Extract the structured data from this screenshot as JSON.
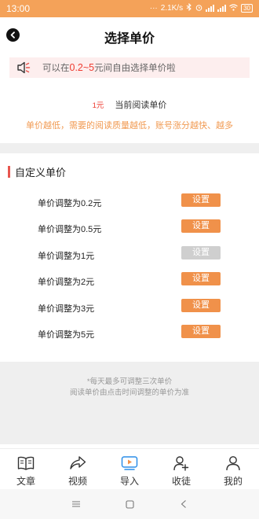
{
  "status_bar": {
    "time": "13:00",
    "dots": "···",
    "network_speed": "2.1K/s",
    "battery": "30"
  },
  "header": {
    "title": "选择单价",
    "back_icon": "chevron-left-circle-icon"
  },
  "notice": {
    "icon": "speaker-icon",
    "prefix": "可以在",
    "range": "0.2~5",
    "suffix": "元间自由选择单价啦"
  },
  "current": {
    "price": "1元",
    "label": "当前阅读单价"
  },
  "hint": "单价越低，需要的阅读质量越低，账号涨分越快、越多",
  "section_title": "自定义单价",
  "options": [
    {
      "label": "单价调整为0.2元",
      "button": "设置",
      "enabled": true
    },
    {
      "label": "单价调整为0.5元",
      "button": "设置",
      "enabled": true
    },
    {
      "label": "单价调整为1元",
      "button": "设置",
      "enabled": false
    },
    {
      "label": "单价调整为2元",
      "button": "设置",
      "enabled": true
    },
    {
      "label": "单价调整为3元",
      "button": "设置",
      "enabled": true
    },
    {
      "label": "单价调整为5元",
      "button": "设置",
      "enabled": true
    }
  ],
  "footer": {
    "note1": "*每天最多可调整三次单价",
    "note2": "阅读单价由点击时间调整的单价为准"
  },
  "tabs": [
    {
      "label": "文章",
      "icon": "book-icon"
    },
    {
      "label": "视频",
      "icon": "share-icon"
    },
    {
      "label": "导入",
      "icon": "video-import-icon"
    },
    {
      "label": "收徒",
      "icon": "add-user-icon"
    },
    {
      "label": "我的",
      "icon": "user-icon"
    }
  ],
  "colors": {
    "accent": "#f0914a",
    "status_bar": "#f4a259",
    "highlight_red": "#ee3b30",
    "disabled": "#cfcfcf",
    "notice_bg": "#fdeeee",
    "tab_active": "#2b8ee8"
  }
}
